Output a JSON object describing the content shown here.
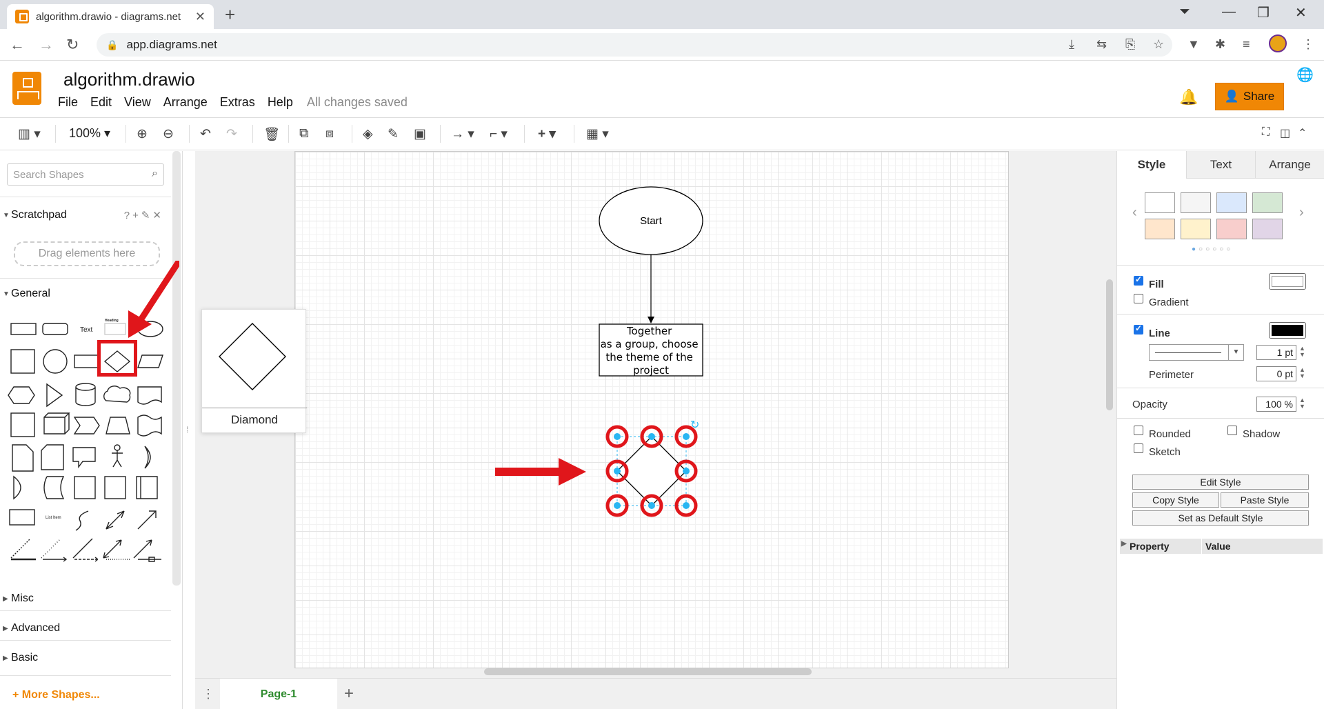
{
  "browser": {
    "tab_title": "algorithm.drawio - diagrams.net",
    "url": "app.diagrams.net"
  },
  "app": {
    "doc_title": "algorithm.drawio",
    "menu": [
      "File",
      "Edit",
      "View",
      "Arrange",
      "Extras",
      "Help"
    ],
    "save_status": "All changes saved",
    "share_label": "Share"
  },
  "toolbar": {
    "zoom": "100%"
  },
  "left": {
    "search_placeholder": "Search Shapes",
    "scratchpad_label": "Scratchpad",
    "drag_hint": "Drag elements here",
    "general_label": "General",
    "misc_label": "Misc",
    "advanced_label": "Advanced",
    "basic_label": "Basic",
    "more_shapes": "More Shapes...",
    "shape_text_label": "Text",
    "shape_listitem_label": "List Item",
    "shape_heading_label": "Heading"
  },
  "preview": {
    "label": "Diamond"
  },
  "diagram": {
    "start_label": "Start",
    "process_lines": [
      "Together",
      "as a group, choose",
      "the theme of the",
      "project"
    ]
  },
  "pages": {
    "tab": "Page-1"
  },
  "right": {
    "tabs": [
      "Style",
      "Text",
      "Arrange"
    ],
    "swatches": [
      "#ffffff",
      "#f5f5f5",
      "#dae8fc",
      "#d5e8d4",
      "#ffe6cc",
      "#fff2cc",
      "#f8cecc",
      "#e1d5e7"
    ],
    "fill_label": "Fill",
    "gradient_label": "Gradient",
    "line_label": "Line",
    "line_width": "1 pt",
    "perimeter_label": "Perimeter",
    "perimeter_value": "0 pt",
    "opacity_label": "Opacity",
    "opacity_value": "100 %",
    "rounded_label": "Rounded",
    "shadow_label": "Shadow",
    "sketch_label": "Sketch",
    "edit_style": "Edit Style",
    "copy_style": "Copy Style",
    "paste_style": "Paste Style",
    "set_default": "Set as Default Style",
    "property_col": "Property",
    "value_col": "Value"
  },
  "colors": {
    "accent": "#f08705",
    "annotation_red": "#e0161b",
    "handle_blue": "#29b6f2",
    "page_tab_green": "#2e8b2e"
  }
}
